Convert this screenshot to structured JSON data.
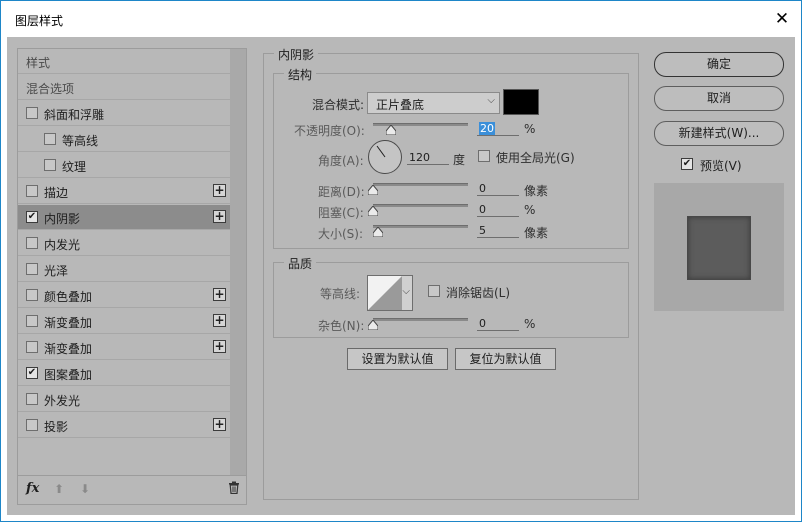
{
  "window": {
    "title": "图层样式",
    "close_glyph": "✕"
  },
  "left_panel": {
    "items": [
      {
        "label": "样式",
        "type": "header"
      },
      {
        "label": "混合选项",
        "type": "header"
      },
      {
        "label": "斜面和浮雕",
        "checked": false,
        "plus": false,
        "indent": 0
      },
      {
        "label": "等高线",
        "checked": false,
        "plus": false,
        "indent": 1
      },
      {
        "label": "纹理",
        "checked": false,
        "plus": false,
        "indent": 1
      },
      {
        "label": "描边",
        "checked": false,
        "plus": true,
        "indent": 0
      },
      {
        "label": "内阴影",
        "checked": true,
        "plus": true,
        "indent": 0,
        "selected": true
      },
      {
        "label": "内发光",
        "checked": false,
        "plus": false,
        "indent": 0
      },
      {
        "label": "光泽",
        "checked": false,
        "plus": false,
        "indent": 0
      },
      {
        "label": "颜色叠加",
        "checked": false,
        "plus": true,
        "indent": 0
      },
      {
        "label": "渐变叠加",
        "checked": false,
        "plus": true,
        "indent": 0
      },
      {
        "label": "渐变叠加",
        "checked": false,
        "plus": true,
        "indent": 0
      },
      {
        "label": "图案叠加",
        "checked": true,
        "plus": false,
        "indent": 0
      },
      {
        "label": "外发光",
        "checked": false,
        "plus": false,
        "indent": 0
      },
      {
        "label": "投影",
        "checked": false,
        "plus": true,
        "indent": 0
      }
    ],
    "footer": {
      "fx_label": "fx",
      "up_glyph": "⬆",
      "down_glyph": "⬇",
      "trash_glyph": "🗑"
    }
  },
  "inner_shadow": {
    "section_title": "内阴影",
    "structure": {
      "title": "结构",
      "blend_mode_label": "混合模式:",
      "blend_mode_value": "正片叠底",
      "shadow_color": "#000000",
      "opacity_label": "不透明度(O):",
      "opacity_value": "20",
      "opacity_unit": "%",
      "angle_label": "角度(A):",
      "angle_value": "120",
      "angle_unit": "度",
      "global_light_label": "使用全局光(G)",
      "global_light_checked": false,
      "distance_label": "距离(D):",
      "distance_value": "0",
      "distance_unit": "像素",
      "choke_label": "阻塞(C):",
      "choke_value": "0",
      "choke_unit": "%",
      "size_label": "大小(S):",
      "size_value": "5",
      "size_unit": "像素"
    },
    "quality": {
      "title": "品质",
      "contour_label": "等高线:",
      "anti_alias_label": "消除锯齿(L)",
      "anti_alias_checked": false,
      "noise_label": "杂色(N):",
      "noise_value": "0",
      "noise_unit": "%"
    },
    "make_default_label": "设置为默认值",
    "reset_default_label": "复位为默认值"
  },
  "right_panel": {
    "ok_label": "确定",
    "cancel_label": "取消",
    "new_style_label": "新建样式(W)...",
    "preview_label": "预览(V)",
    "preview_checked": true
  }
}
